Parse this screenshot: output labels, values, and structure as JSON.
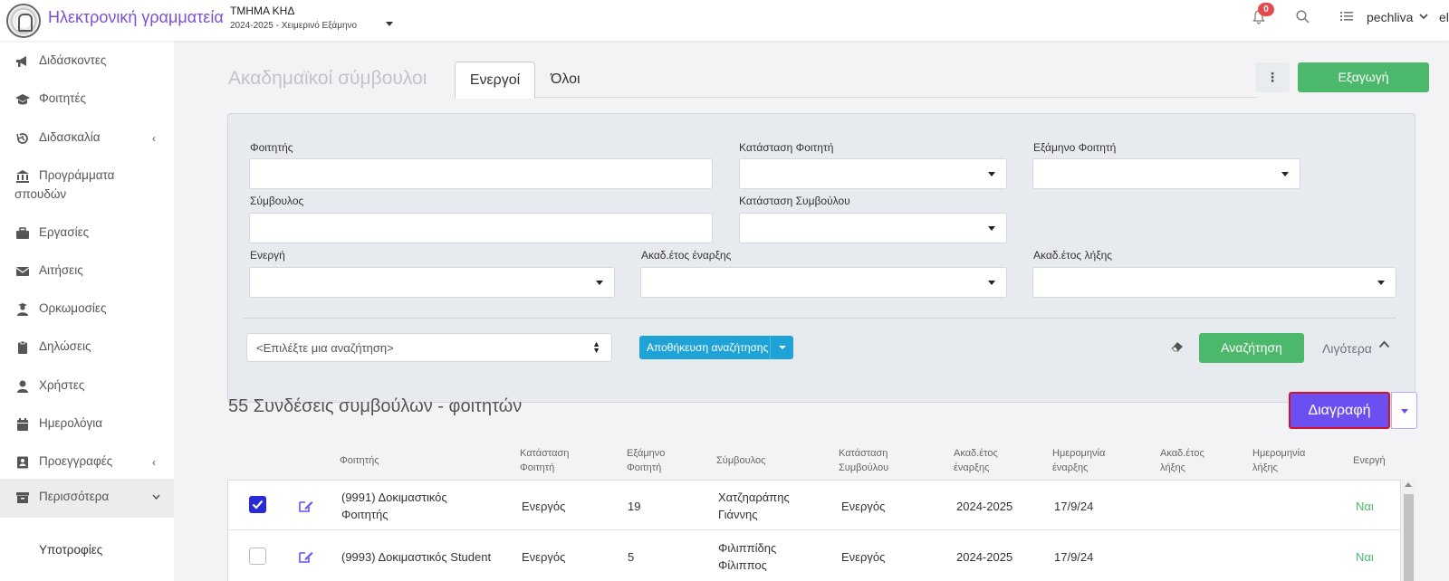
{
  "header": {
    "app_title": "Ηλεκτρονική γραμματεία",
    "department": "ΤΜΗΜΑ ΚΗΔ",
    "semester": "2024-2025 - Χειμερινό Εξάμηνο",
    "notifications_count": "0",
    "username": "pechliva",
    "language": "el"
  },
  "sidebar": {
    "items": [
      {
        "label": "Διδάσκοντες",
        "icon": "megaphone-icon"
      },
      {
        "label": "Φοιτητές",
        "icon": "graduation-cap-icon"
      },
      {
        "label": "Διδασκαλία",
        "icon": "history-icon"
      },
      {
        "label": "Προγράμματα",
        "label2": "σπουδών",
        "icon": "institution-icon"
      },
      {
        "label": "Εργασίες",
        "icon": "briefcase-icon"
      },
      {
        "label": "Αιτήσεις",
        "icon": "envelope-icon"
      },
      {
        "label": "Ορκωμοσίες",
        "icon": "graduate-user-icon"
      },
      {
        "label": "Δηλώσεις",
        "icon": "clipboard-icon"
      },
      {
        "label": "Χρήστες",
        "icon": "user-icon"
      },
      {
        "label": "Ημερολόγια",
        "icon": "calendar-icon"
      },
      {
        "label": "Προεγγραφές",
        "icon": "address-card-icon"
      },
      {
        "label": "Περισσότερα",
        "icon": "archive-icon"
      }
    ],
    "sub_item": "Υποτροφίες"
  },
  "page": {
    "title": "Ακαδημαϊκοί σύμβουλοι",
    "tabs": [
      {
        "label": "Ενεργοί"
      },
      {
        "label": "Όλοι"
      }
    ],
    "more_button": "⋮",
    "export_label": "Εξαγωγή"
  },
  "filters": {
    "student": "Φοιτητής",
    "student_status": "Κατάσταση Φοιτητή",
    "student_semester": "Εξάμηνο Φοιτητή",
    "advisor": "Σύμβουλος",
    "advisor_status": "Κατάσταση Συμβούλου",
    "active": "Ενεργή",
    "start_year": "Ακαδ.έτος έναρξης",
    "end_year": "Ακαδ.έτος λήξης",
    "saved_search_placeholder": "<Επιλέξτε μια αναζήτηση>",
    "save_search_label": "Αποθήκευση αναζήτησης",
    "search_label": "Αναζήτηση",
    "less_label": "Λιγότερα"
  },
  "results": {
    "title": "55 Συνδέσεις συμβούλων - φοιτητών",
    "delete_label": "Διαγραφή",
    "columns": [
      [
        "Φοιτητής"
      ],
      [
        "Κατάσταση",
        "Φοιτητή"
      ],
      [
        "Εξάμηνο",
        "Φοιτητή"
      ],
      [
        "Σύμβουλος"
      ],
      [
        "Κατάσταση",
        "Συμβούλου"
      ],
      [
        "Ακαδ.έτος",
        "έναρξης"
      ],
      [
        "Ημερομηνία",
        "έναρξης"
      ],
      [
        "Ακαδ.έτος",
        "λήξης"
      ],
      [
        "Ημερομηνία",
        "λήξης"
      ],
      [
        "Ενεργή"
      ]
    ],
    "rows": [
      {
        "checked": true,
        "student": [
          "(9991) Δοκιμαστικός",
          "Φοιτητής"
        ],
        "student_status": "Ενεργός",
        "semester": "19",
        "advisor": [
          "Χατζηαράπης",
          "Γιάννης"
        ],
        "advisor_status": "Ενεργός",
        "start_year": "2024-2025",
        "start_date": "17/9/24",
        "active": "Ναι"
      },
      {
        "checked": false,
        "student": [
          "(9993) Δοκιμαστικός Student"
        ],
        "student_status": "Ενεργός",
        "semester": "5",
        "advisor": [
          "Φιλιππίδης",
          "Φίλιππος"
        ],
        "advisor_status": "Ενεργός",
        "start_year": "2024-2025",
        "start_date": "17/9/24",
        "active": "Ναι"
      }
    ]
  },
  "colors": {
    "brand": "#7b4fd6",
    "success": "#4cb86b",
    "info": "#1fa3d6",
    "delete": "#6c4ff0",
    "danger_outline": "#d6122a"
  }
}
